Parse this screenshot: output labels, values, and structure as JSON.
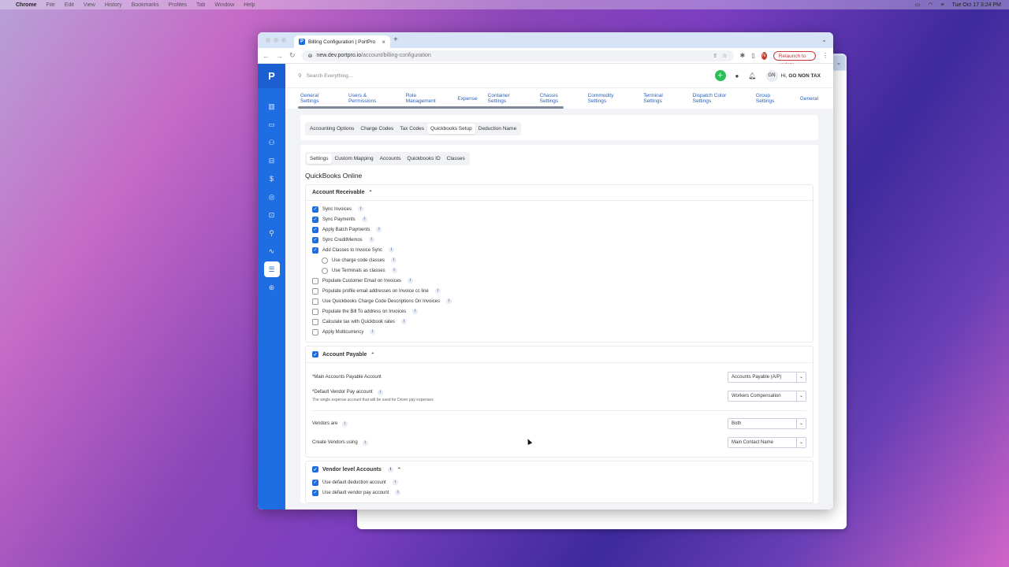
{
  "macmenu": {
    "app": "Chrome",
    "items": [
      "File",
      "Edit",
      "View",
      "History",
      "Bookmarks",
      "Profiles",
      "Tab",
      "Window",
      "Help"
    ],
    "clock": "Tue Oct 17  3:24 PM"
  },
  "browser": {
    "tab_title": "Billing Configuration | PortPro",
    "url_host": "new.dev.portpro.io",
    "url_path": "/account/billing-configuration",
    "profile_initial": "N",
    "relaunch_label": "Relaunch to update"
  },
  "topbar": {
    "search_placeholder": "Search Everything...",
    "avatar_initials": "GN",
    "greeting_prefix": "Hi,",
    "greeting_name": "GO NON TAX"
  },
  "settings_tabs": [
    "General Settings",
    "Users & Permissions",
    "Role Management",
    "Expense",
    "Container Settings",
    "Chassis Settings",
    "Commodity Settings",
    "Terminal Settings",
    "Dispatch Color Settings",
    "Group Settings",
    "General"
  ],
  "billing_tabs": [
    "Accounting Options",
    "Charge Codes",
    "Tax Codes",
    "Quickbooks Setup",
    "Deduction Name"
  ],
  "billing_active": "Quickbooks Setup",
  "qb_tabs": [
    "Settings",
    "Custom Mapping",
    "Accounts",
    "Quickbooks ID",
    "Classes"
  ],
  "qb_active": "Settings",
  "page_title": "QuickBooks Online",
  "ar": {
    "title": "Account Receivable",
    "items": [
      {
        "label": "Sync Invoices",
        "checked": true,
        "type": "cb",
        "indent": false
      },
      {
        "label": "Sync Payments",
        "checked": true,
        "type": "cb",
        "indent": false
      },
      {
        "label": "Apply Batch Payments",
        "checked": true,
        "type": "cb",
        "indent": false
      },
      {
        "label": "Sync CreditMemos",
        "checked": true,
        "type": "cb",
        "indent": false
      },
      {
        "label": "Add Classes to Invoice Sync",
        "checked": true,
        "type": "cb",
        "indent": false
      },
      {
        "label": "Use charge code classes",
        "checked": false,
        "type": "radio",
        "indent": true
      },
      {
        "label": "Use Terminals as classes",
        "checked": false,
        "type": "radio",
        "indent": true
      },
      {
        "label": "Populate Customer Email on Invoices",
        "checked": false,
        "type": "cb",
        "indent": false
      },
      {
        "label": "Populate profile email addresses on Invoice cc line",
        "checked": false,
        "type": "cb",
        "indent": false
      },
      {
        "label": "Use Quickbooks Charge Code Descriptions On Invoices",
        "checked": false,
        "type": "cb",
        "indent": false
      },
      {
        "label": "Populate the Bill To address on Invoices",
        "checked": false,
        "type": "cb",
        "indent": false
      },
      {
        "label": "Calculate tax with Quickbook rates",
        "checked": false,
        "type": "cb",
        "indent": false
      },
      {
        "label": "Apply Multicurrency",
        "checked": false,
        "type": "cb",
        "indent": false
      }
    ]
  },
  "ap": {
    "title": "Account Payable",
    "main_account_label": "*Main Accounts Payable Account",
    "main_account_value": "Accounts Payable (A/P)",
    "vendor_pay_label": "*Default Vendor Pay account",
    "vendor_pay_sub": "The single expense account that will be used for Driver pay expenses",
    "vendor_pay_value": "Workers Compensation",
    "vendors_are_label": "Vendors are",
    "vendors_are_value": "Both",
    "create_vendors_label": "Create Vendors using",
    "create_vendors_value": "Main Contact Name"
  },
  "vla": {
    "title": "Vendor level Accounts",
    "items": [
      {
        "label": "Use default deduction account",
        "checked": true
      },
      {
        "label": "Use default vendor pay account",
        "checked": true
      }
    ]
  }
}
